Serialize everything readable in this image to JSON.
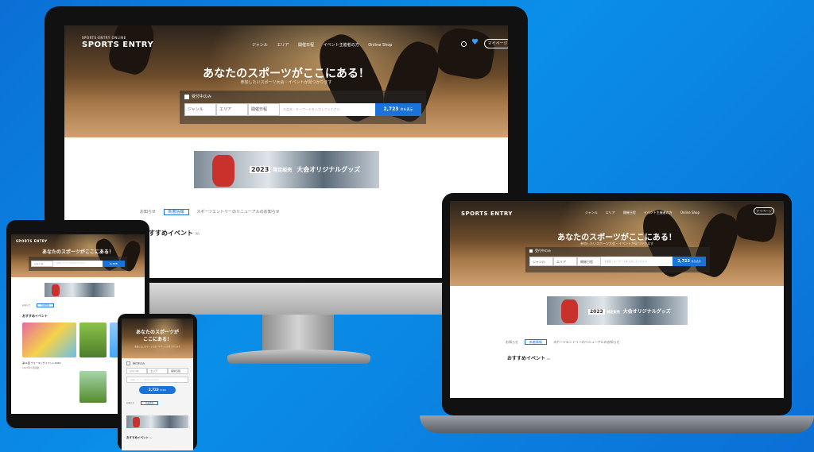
{
  "site": {
    "logo_small": "SPORTS·ENTRY ONLINE",
    "logo": "SPORTS ENTRY",
    "nav": [
      "ジャンル",
      "エリア",
      "開催日程",
      "イベント主催者の方",
      "Online Shop"
    ],
    "mypage": "マイページ",
    "hero_title": "あなたのスポーツがここにある！",
    "hero_title_mobile_1": "あなたのスポーツが",
    "hero_title_mobile_2": "ここにある！",
    "hero_sub": "参加したいスポーツ大会・イベントが見つかります",
    "checkbox_label": "受付中のみ",
    "genre_placeholder": "ジャンル",
    "area_placeholder": "エリア",
    "date_placeholder": "開催日程",
    "keyword_placeholder": "大会名・キーワードを入力してください",
    "count": "2,723",
    "count_suffix": "件を表示",
    "banner_year": "2023",
    "banner_tag": "限定販売",
    "banner_text": "大会オリジナルグッズ",
    "tabs": [
      "お知らせ",
      "新着情報",
      "スポーツエントリーのリニューアルのお知らせ"
    ],
    "section": "おすすめイベント",
    "section_tag": "PR",
    "card_title": "第11回 ウォーキングイベント2023",
    "card_date": "2023年3月開催"
  },
  "colors": {
    "background": "#0b6fd6",
    "accent": "#1a73d9",
    "heart": "#3aa0ff"
  }
}
